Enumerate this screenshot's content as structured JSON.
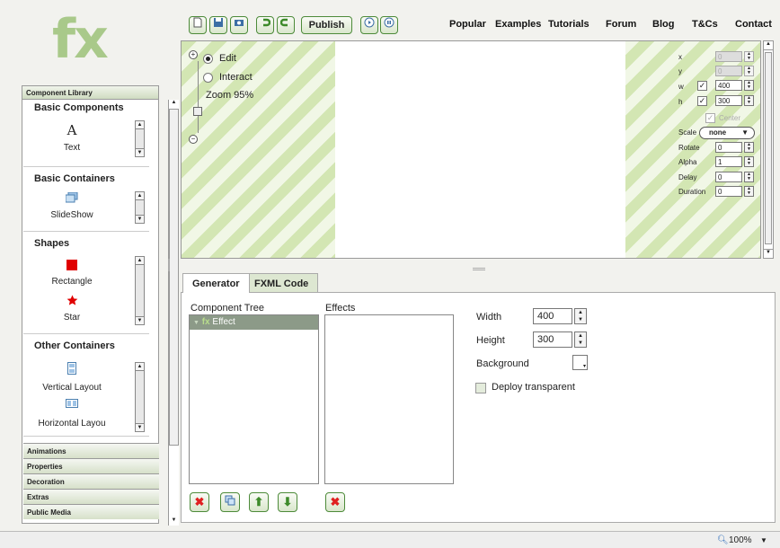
{
  "logo": {
    "text": "fx"
  },
  "toolbar": {
    "publish": "Publish"
  },
  "nav": [
    "Popular",
    "Examples",
    "Tutorials",
    "Forum",
    "Blog",
    "T&Cs",
    "Contact"
  ],
  "library": {
    "title": "Component Library",
    "sections": [
      {
        "title": "Basic Components",
        "items": [
          "Text"
        ]
      },
      {
        "title": "Basic Containers",
        "items": [
          "SlideShow"
        ]
      },
      {
        "title": "Shapes",
        "items": [
          "Rectangle",
          "Star"
        ]
      },
      {
        "title": "Other Containers",
        "items": [
          "Vertical Layout",
          "Horizontal Layou"
        ]
      }
    ],
    "accordion": [
      "Animations",
      "Properties",
      "Decoration",
      "Extras",
      "Public Media"
    ]
  },
  "stage": {
    "mode_edit": "Edit",
    "mode_interact": "Interact",
    "zoom": "Zoom 95%",
    "props": {
      "x_label": "x",
      "x": "0",
      "y_label": "y",
      "y": "0",
      "w_label": "w",
      "w": "400",
      "h_label": "h",
      "h": "300",
      "center": "Center",
      "scale_label": "Scale",
      "scale": "none",
      "rotate_label": "Rotate",
      "rotate": "0",
      "alpha_label": "Alpha",
      "alpha": "1",
      "delay_label": "Delay",
      "delay": "0",
      "duration_label": "Duration",
      "duration": "0"
    }
  },
  "tabs": [
    "Generator",
    "FXML Code"
  ],
  "generator": {
    "tree_label": "Component Tree",
    "tree_item": "Effect",
    "effects_label": "Effects",
    "width_label": "Width",
    "width": "400",
    "height_label": "Height",
    "height": "300",
    "background_label": "Background",
    "deploy_label": "Deploy transparent"
  },
  "status": {
    "zoom": "100%"
  }
}
